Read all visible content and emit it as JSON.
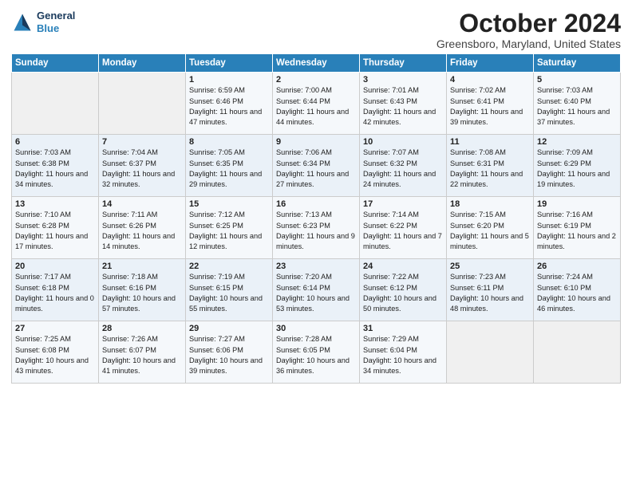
{
  "logo": {
    "line1": "General",
    "line2": "Blue"
  },
  "title": "October 2024",
  "subtitle": "Greensboro, Maryland, United States",
  "days_of_week": [
    "Sunday",
    "Monday",
    "Tuesday",
    "Wednesday",
    "Thursday",
    "Friday",
    "Saturday"
  ],
  "weeks": [
    [
      {
        "day": "",
        "sunrise": "",
        "sunset": "",
        "daylight": ""
      },
      {
        "day": "",
        "sunrise": "",
        "sunset": "",
        "daylight": ""
      },
      {
        "day": "1",
        "sunrise": "Sunrise: 6:59 AM",
        "sunset": "Sunset: 6:46 PM",
        "daylight": "Daylight: 11 hours and 47 minutes."
      },
      {
        "day": "2",
        "sunrise": "Sunrise: 7:00 AM",
        "sunset": "Sunset: 6:44 PM",
        "daylight": "Daylight: 11 hours and 44 minutes."
      },
      {
        "day": "3",
        "sunrise": "Sunrise: 7:01 AM",
        "sunset": "Sunset: 6:43 PM",
        "daylight": "Daylight: 11 hours and 42 minutes."
      },
      {
        "day": "4",
        "sunrise": "Sunrise: 7:02 AM",
        "sunset": "Sunset: 6:41 PM",
        "daylight": "Daylight: 11 hours and 39 minutes."
      },
      {
        "day": "5",
        "sunrise": "Sunrise: 7:03 AM",
        "sunset": "Sunset: 6:40 PM",
        "daylight": "Daylight: 11 hours and 37 minutes."
      }
    ],
    [
      {
        "day": "6",
        "sunrise": "Sunrise: 7:03 AM",
        "sunset": "Sunset: 6:38 PM",
        "daylight": "Daylight: 11 hours and 34 minutes."
      },
      {
        "day": "7",
        "sunrise": "Sunrise: 7:04 AM",
        "sunset": "Sunset: 6:37 PM",
        "daylight": "Daylight: 11 hours and 32 minutes."
      },
      {
        "day": "8",
        "sunrise": "Sunrise: 7:05 AM",
        "sunset": "Sunset: 6:35 PM",
        "daylight": "Daylight: 11 hours and 29 minutes."
      },
      {
        "day": "9",
        "sunrise": "Sunrise: 7:06 AM",
        "sunset": "Sunset: 6:34 PM",
        "daylight": "Daylight: 11 hours and 27 minutes."
      },
      {
        "day": "10",
        "sunrise": "Sunrise: 7:07 AM",
        "sunset": "Sunset: 6:32 PM",
        "daylight": "Daylight: 11 hours and 24 minutes."
      },
      {
        "day": "11",
        "sunrise": "Sunrise: 7:08 AM",
        "sunset": "Sunset: 6:31 PM",
        "daylight": "Daylight: 11 hours and 22 minutes."
      },
      {
        "day": "12",
        "sunrise": "Sunrise: 7:09 AM",
        "sunset": "Sunset: 6:29 PM",
        "daylight": "Daylight: 11 hours and 19 minutes."
      }
    ],
    [
      {
        "day": "13",
        "sunrise": "Sunrise: 7:10 AM",
        "sunset": "Sunset: 6:28 PM",
        "daylight": "Daylight: 11 hours and 17 minutes."
      },
      {
        "day": "14",
        "sunrise": "Sunrise: 7:11 AM",
        "sunset": "Sunset: 6:26 PM",
        "daylight": "Daylight: 11 hours and 14 minutes."
      },
      {
        "day": "15",
        "sunrise": "Sunrise: 7:12 AM",
        "sunset": "Sunset: 6:25 PM",
        "daylight": "Daylight: 11 hours and 12 minutes."
      },
      {
        "day": "16",
        "sunrise": "Sunrise: 7:13 AM",
        "sunset": "Sunset: 6:23 PM",
        "daylight": "Daylight: 11 hours and 9 minutes."
      },
      {
        "day": "17",
        "sunrise": "Sunrise: 7:14 AM",
        "sunset": "Sunset: 6:22 PM",
        "daylight": "Daylight: 11 hours and 7 minutes."
      },
      {
        "day": "18",
        "sunrise": "Sunrise: 7:15 AM",
        "sunset": "Sunset: 6:20 PM",
        "daylight": "Daylight: 11 hours and 5 minutes."
      },
      {
        "day": "19",
        "sunrise": "Sunrise: 7:16 AM",
        "sunset": "Sunset: 6:19 PM",
        "daylight": "Daylight: 11 hours and 2 minutes."
      }
    ],
    [
      {
        "day": "20",
        "sunrise": "Sunrise: 7:17 AM",
        "sunset": "Sunset: 6:18 PM",
        "daylight": "Daylight: 11 hours and 0 minutes."
      },
      {
        "day": "21",
        "sunrise": "Sunrise: 7:18 AM",
        "sunset": "Sunset: 6:16 PM",
        "daylight": "Daylight: 10 hours and 57 minutes."
      },
      {
        "day": "22",
        "sunrise": "Sunrise: 7:19 AM",
        "sunset": "Sunset: 6:15 PM",
        "daylight": "Daylight: 10 hours and 55 minutes."
      },
      {
        "day": "23",
        "sunrise": "Sunrise: 7:20 AM",
        "sunset": "Sunset: 6:14 PM",
        "daylight": "Daylight: 10 hours and 53 minutes."
      },
      {
        "day": "24",
        "sunrise": "Sunrise: 7:22 AM",
        "sunset": "Sunset: 6:12 PM",
        "daylight": "Daylight: 10 hours and 50 minutes."
      },
      {
        "day": "25",
        "sunrise": "Sunrise: 7:23 AM",
        "sunset": "Sunset: 6:11 PM",
        "daylight": "Daylight: 10 hours and 48 minutes."
      },
      {
        "day": "26",
        "sunrise": "Sunrise: 7:24 AM",
        "sunset": "Sunset: 6:10 PM",
        "daylight": "Daylight: 10 hours and 46 minutes."
      }
    ],
    [
      {
        "day": "27",
        "sunrise": "Sunrise: 7:25 AM",
        "sunset": "Sunset: 6:08 PM",
        "daylight": "Daylight: 10 hours and 43 minutes."
      },
      {
        "day": "28",
        "sunrise": "Sunrise: 7:26 AM",
        "sunset": "Sunset: 6:07 PM",
        "daylight": "Daylight: 10 hours and 41 minutes."
      },
      {
        "day": "29",
        "sunrise": "Sunrise: 7:27 AM",
        "sunset": "Sunset: 6:06 PM",
        "daylight": "Daylight: 10 hours and 39 minutes."
      },
      {
        "day": "30",
        "sunrise": "Sunrise: 7:28 AM",
        "sunset": "Sunset: 6:05 PM",
        "daylight": "Daylight: 10 hours and 36 minutes."
      },
      {
        "day": "31",
        "sunrise": "Sunrise: 7:29 AM",
        "sunset": "Sunset: 6:04 PM",
        "daylight": "Daylight: 10 hours and 34 minutes."
      },
      {
        "day": "",
        "sunrise": "",
        "sunset": "",
        "daylight": ""
      },
      {
        "day": "",
        "sunrise": "",
        "sunset": "",
        "daylight": ""
      }
    ]
  ]
}
